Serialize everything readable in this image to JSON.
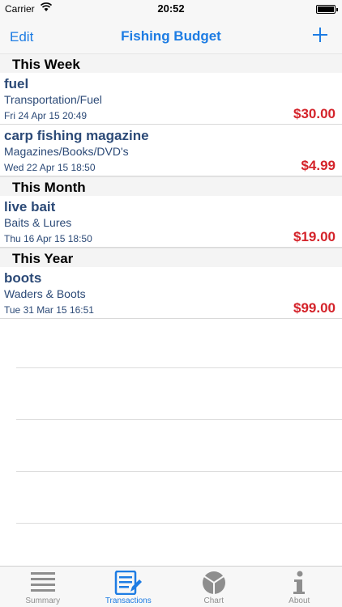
{
  "status": {
    "carrier": "Carrier",
    "time": "20:52"
  },
  "nav": {
    "edit_label": "Edit",
    "title": "Fishing Budget"
  },
  "sections": [
    {
      "header": "This Week",
      "items": [
        {
          "name": "fuel",
          "category": "Transportation/Fuel",
          "date": "Fri 24 Apr 15 20:49",
          "amount": "$30.00"
        },
        {
          "name": "carp fishing magazine",
          "category": "Magazines/Books/DVD's",
          "date": "Wed 22 Apr 15 18:50",
          "amount": "$4.99"
        }
      ]
    },
    {
      "header": "This Month",
      "items": [
        {
          "name": "live bait",
          "category": "Baits & Lures",
          "date": "Thu 16 Apr 15 18:50",
          "amount": "$19.00"
        }
      ]
    },
    {
      "header": "This Year",
      "items": [
        {
          "name": "boots",
          "category": "Waders & Boots",
          "date": "Tue 31 Mar 15 16:51",
          "amount": "$99.00"
        }
      ]
    }
  ],
  "tabs": [
    {
      "label": "Summary",
      "icon": "list-lines-icon"
    },
    {
      "label": "Transactions",
      "icon": "transactions-edit-icon"
    },
    {
      "label": "Chart",
      "icon": "pie-chart-icon"
    },
    {
      "label": "About",
      "icon": "info-icon"
    }
  ],
  "colors": {
    "accent": "#1d7ce3",
    "amount": "#d4232a",
    "text": "#2c4a77"
  }
}
